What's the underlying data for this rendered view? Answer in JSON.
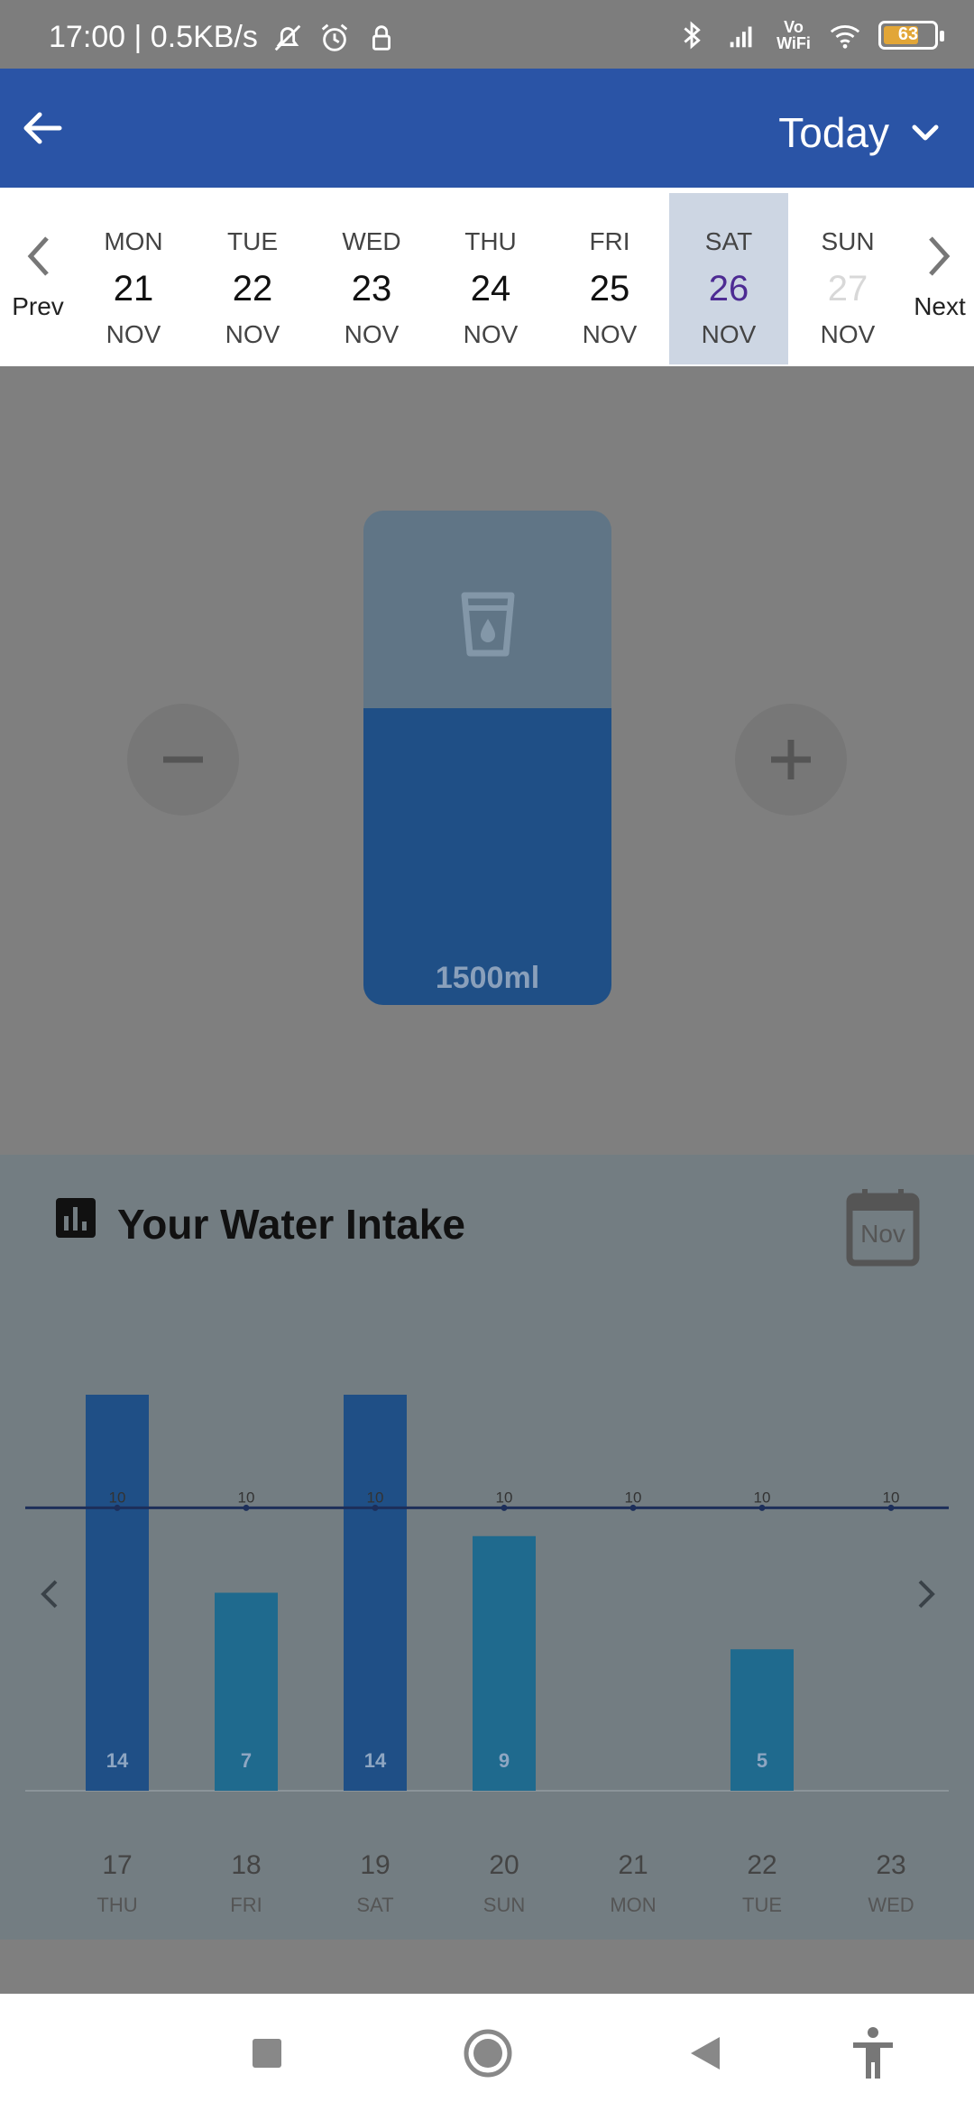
{
  "status_bar": {
    "time_speed": "17:00 | 0.5KB/s",
    "battery": "63",
    "network": "Vo WiFi"
  },
  "appbar": {
    "range_label": "Today"
  },
  "date_strip": {
    "prev_label": "Prev",
    "next_label": "Next",
    "days": [
      {
        "dow": "MON",
        "num": "21",
        "mon": "NOV",
        "state": "normal"
      },
      {
        "dow": "TUE",
        "num": "22",
        "mon": "NOV",
        "state": "normal"
      },
      {
        "dow": "WED",
        "num": "23",
        "mon": "NOV",
        "state": "normal"
      },
      {
        "dow": "THU",
        "num": "24",
        "mon": "NOV",
        "state": "normal"
      },
      {
        "dow": "FRI",
        "num": "25",
        "mon": "NOV",
        "state": "normal"
      },
      {
        "dow": "SAT",
        "num": "26",
        "mon": "NOV",
        "state": "selected"
      },
      {
        "dow": "SUN",
        "num": "27",
        "mon": "NOV",
        "state": "future"
      }
    ]
  },
  "tracker": {
    "amount_label": "1500ml",
    "fill_level": 0.6,
    "decrease_icon": "minus-icon",
    "increase_icon": "plus-icon"
  },
  "intake_card": {
    "title": "Your Water Intake",
    "month_label": "Nov"
  },
  "chart_data": {
    "type": "bar",
    "categories": [
      "17",
      "18",
      "19",
      "20",
      "21",
      "22",
      "23"
    ],
    "weekdays": [
      "THU",
      "FRI",
      "SAT",
      "SUN",
      "MON",
      "TUE",
      "WED"
    ],
    "values": [
      14,
      7,
      14,
      9,
      0,
      5,
      0
    ],
    "value_labels": [
      "14",
      "7",
      "14",
      "9",
      "",
      "5",
      ""
    ],
    "goal": 10,
    "goal_labels": [
      "10",
      "10",
      "10",
      "10",
      "10",
      "10",
      "10"
    ],
    "ylim": [
      0,
      14
    ],
    "bar_colors": [
      "#1f4f86",
      "#1f6a8e",
      "#1f4f86",
      "#1f6a8e",
      "#1f6a8e",
      "#1f6a8e",
      "#1f6a8e"
    ],
    "goal_line_color": "#1d2f5a",
    "title": "",
    "xlabel": "",
    "ylabel": ""
  },
  "colors": {
    "appbar": "#2a54a6",
    "selected_day_bg": "#cdd6e3",
    "selected_day_text": "#4d2b93"
  }
}
